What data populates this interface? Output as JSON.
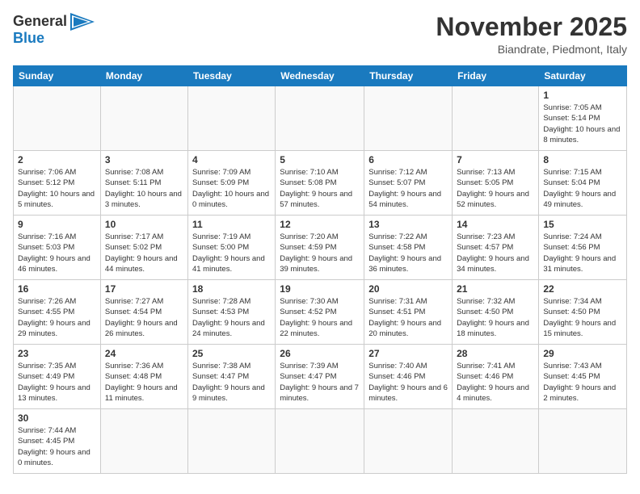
{
  "header": {
    "logo_general": "General",
    "logo_blue": "Blue",
    "month_title": "November 2025",
    "location": "Biandrate, Piedmont, Italy"
  },
  "weekdays": [
    "Sunday",
    "Monday",
    "Tuesday",
    "Wednesday",
    "Thursday",
    "Friday",
    "Saturday"
  ],
  "days": {
    "d1": {
      "num": "1",
      "sunrise": "Sunrise: 7:05 AM",
      "sunset": "Sunset: 5:14 PM",
      "daylight": "Daylight: 10 hours and 8 minutes."
    },
    "d2": {
      "num": "2",
      "sunrise": "Sunrise: 7:06 AM",
      "sunset": "Sunset: 5:12 PM",
      "daylight": "Daylight: 10 hours and 5 minutes."
    },
    "d3": {
      "num": "3",
      "sunrise": "Sunrise: 7:08 AM",
      "sunset": "Sunset: 5:11 PM",
      "daylight": "Daylight: 10 hours and 3 minutes."
    },
    "d4": {
      "num": "4",
      "sunrise": "Sunrise: 7:09 AM",
      "sunset": "Sunset: 5:09 PM",
      "daylight": "Daylight: 10 hours and 0 minutes."
    },
    "d5": {
      "num": "5",
      "sunrise": "Sunrise: 7:10 AM",
      "sunset": "Sunset: 5:08 PM",
      "daylight": "Daylight: 9 hours and 57 minutes."
    },
    "d6": {
      "num": "6",
      "sunrise": "Sunrise: 7:12 AM",
      "sunset": "Sunset: 5:07 PM",
      "daylight": "Daylight: 9 hours and 54 minutes."
    },
    "d7": {
      "num": "7",
      "sunrise": "Sunrise: 7:13 AM",
      "sunset": "Sunset: 5:05 PM",
      "daylight": "Daylight: 9 hours and 52 minutes."
    },
    "d8": {
      "num": "8",
      "sunrise": "Sunrise: 7:15 AM",
      "sunset": "Sunset: 5:04 PM",
      "daylight": "Daylight: 9 hours and 49 minutes."
    },
    "d9": {
      "num": "9",
      "sunrise": "Sunrise: 7:16 AM",
      "sunset": "Sunset: 5:03 PM",
      "daylight": "Daylight: 9 hours and 46 minutes."
    },
    "d10": {
      "num": "10",
      "sunrise": "Sunrise: 7:17 AM",
      "sunset": "Sunset: 5:02 PM",
      "daylight": "Daylight: 9 hours and 44 minutes."
    },
    "d11": {
      "num": "11",
      "sunrise": "Sunrise: 7:19 AM",
      "sunset": "Sunset: 5:00 PM",
      "daylight": "Daylight: 9 hours and 41 minutes."
    },
    "d12": {
      "num": "12",
      "sunrise": "Sunrise: 7:20 AM",
      "sunset": "Sunset: 4:59 PM",
      "daylight": "Daylight: 9 hours and 39 minutes."
    },
    "d13": {
      "num": "13",
      "sunrise": "Sunrise: 7:22 AM",
      "sunset": "Sunset: 4:58 PM",
      "daylight": "Daylight: 9 hours and 36 minutes."
    },
    "d14": {
      "num": "14",
      "sunrise": "Sunrise: 7:23 AM",
      "sunset": "Sunset: 4:57 PM",
      "daylight": "Daylight: 9 hours and 34 minutes."
    },
    "d15": {
      "num": "15",
      "sunrise": "Sunrise: 7:24 AM",
      "sunset": "Sunset: 4:56 PM",
      "daylight": "Daylight: 9 hours and 31 minutes."
    },
    "d16": {
      "num": "16",
      "sunrise": "Sunrise: 7:26 AM",
      "sunset": "Sunset: 4:55 PM",
      "daylight": "Daylight: 9 hours and 29 minutes."
    },
    "d17": {
      "num": "17",
      "sunrise": "Sunrise: 7:27 AM",
      "sunset": "Sunset: 4:54 PM",
      "daylight": "Daylight: 9 hours and 26 minutes."
    },
    "d18": {
      "num": "18",
      "sunrise": "Sunrise: 7:28 AM",
      "sunset": "Sunset: 4:53 PM",
      "daylight": "Daylight: 9 hours and 24 minutes."
    },
    "d19": {
      "num": "19",
      "sunrise": "Sunrise: 7:30 AM",
      "sunset": "Sunset: 4:52 PM",
      "daylight": "Daylight: 9 hours and 22 minutes."
    },
    "d20": {
      "num": "20",
      "sunrise": "Sunrise: 7:31 AM",
      "sunset": "Sunset: 4:51 PM",
      "daylight": "Daylight: 9 hours and 20 minutes."
    },
    "d21": {
      "num": "21",
      "sunrise": "Sunrise: 7:32 AM",
      "sunset": "Sunset: 4:50 PM",
      "daylight": "Daylight: 9 hours and 18 minutes."
    },
    "d22": {
      "num": "22",
      "sunrise": "Sunrise: 7:34 AM",
      "sunset": "Sunset: 4:50 PM",
      "daylight": "Daylight: 9 hours and 15 minutes."
    },
    "d23": {
      "num": "23",
      "sunrise": "Sunrise: 7:35 AM",
      "sunset": "Sunset: 4:49 PM",
      "daylight": "Daylight: 9 hours and 13 minutes."
    },
    "d24": {
      "num": "24",
      "sunrise": "Sunrise: 7:36 AM",
      "sunset": "Sunset: 4:48 PM",
      "daylight": "Daylight: 9 hours and 11 minutes."
    },
    "d25": {
      "num": "25",
      "sunrise": "Sunrise: 7:38 AM",
      "sunset": "Sunset: 4:47 PM",
      "daylight": "Daylight: 9 hours and 9 minutes."
    },
    "d26": {
      "num": "26",
      "sunrise": "Sunrise: 7:39 AM",
      "sunset": "Sunset: 4:47 PM",
      "daylight": "Daylight: 9 hours and 7 minutes."
    },
    "d27": {
      "num": "27",
      "sunrise": "Sunrise: 7:40 AM",
      "sunset": "Sunset: 4:46 PM",
      "daylight": "Daylight: 9 hours and 6 minutes."
    },
    "d28": {
      "num": "28",
      "sunrise": "Sunrise: 7:41 AM",
      "sunset": "Sunset: 4:46 PM",
      "daylight": "Daylight: 9 hours and 4 minutes."
    },
    "d29": {
      "num": "29",
      "sunrise": "Sunrise: 7:43 AM",
      "sunset": "Sunset: 4:45 PM",
      "daylight": "Daylight: 9 hours and 2 minutes."
    },
    "d30": {
      "num": "30",
      "sunrise": "Sunrise: 7:44 AM",
      "sunset": "Sunset: 4:45 PM",
      "daylight": "Daylight: 9 hours and 0 minutes."
    }
  }
}
